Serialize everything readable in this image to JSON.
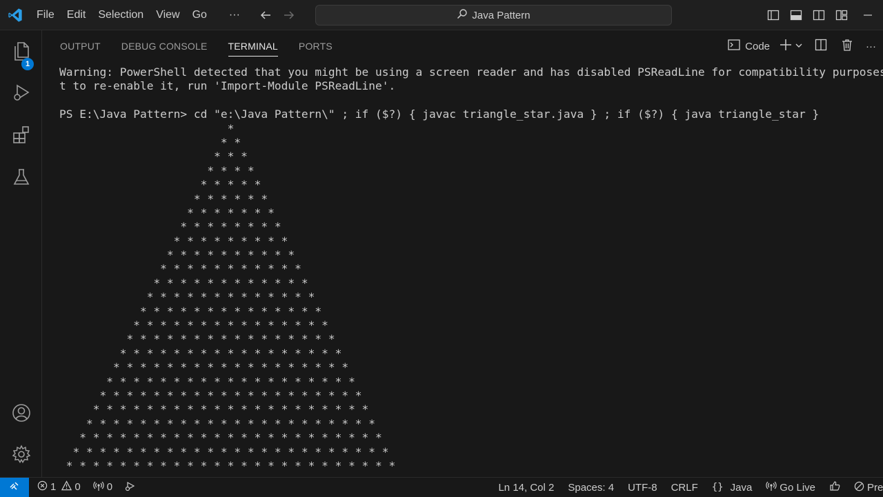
{
  "titlebar": {
    "menu": [
      "File",
      "Edit",
      "Selection",
      "View",
      "Go",
      "···"
    ],
    "search_text": "Java Pattern"
  },
  "activity_bar": {
    "explorer_badge": "1"
  },
  "panel": {
    "tabs": [
      "OUTPUT",
      "DEBUG CONSOLE",
      "TERMINAL",
      "PORTS"
    ],
    "active_tab": "TERMINAL",
    "terminal_profile": "Code"
  },
  "terminal": {
    "lines": [
      "Warning: PowerShell detected that you might be using a screen reader and has disabled PSReadLine for compatibility purposes. If you want",
      "t to re-enable it, run 'Import-Module PSReadLine'.",
      "",
      "PS E:\\Java Pattern> cd \"e:\\Java Pattern\\\" ; if ($?) { javac triangle_star.java } ; if ($?) { java triangle_star }",
      "                         *",
      "                        * *",
      "                       * * *",
      "                      * * * *",
      "                     * * * * *",
      "                    * * * * * *",
      "                   * * * * * * *",
      "                  * * * * * * * *",
      "                 * * * * * * * * *",
      "                * * * * * * * * * *",
      "               * * * * * * * * * * *",
      "              * * * * * * * * * * * *",
      "             * * * * * * * * * * * * *",
      "            * * * * * * * * * * * * * *",
      "           * * * * * * * * * * * * * * *",
      "          * * * * * * * * * * * * * * * *",
      "         * * * * * * * * * * * * * * * * *",
      "        * * * * * * * * * * * * * * * * * *",
      "       * * * * * * * * * * * * * * * * * * *",
      "      * * * * * * * * * * * * * * * * * * * *",
      "     * * * * * * * * * * * * * * * * * * * * *",
      "    * * * * * * * * * * * * * * * * * * * * * *",
      "   * * * * * * * * * * * * * * * * * * * * * * *",
      "  * * * * * * * * * * * * * * * * * * * * * * * *",
      " * * * * * * * * * * * * * * * * * * * * * * * * *"
    ]
  },
  "statusbar": {
    "errors": "1",
    "warnings": "0",
    "ports": "0",
    "position": "Ln 14, Col 2",
    "spaces": "Spaces: 4",
    "encoding": "UTF-8",
    "eol": "CRLF",
    "language": "Java",
    "go_live": "Go Live",
    "prettier": "Prett"
  },
  "colors": {
    "accent": "#0078d4",
    "background": "#181818",
    "text": "#cccccc"
  }
}
